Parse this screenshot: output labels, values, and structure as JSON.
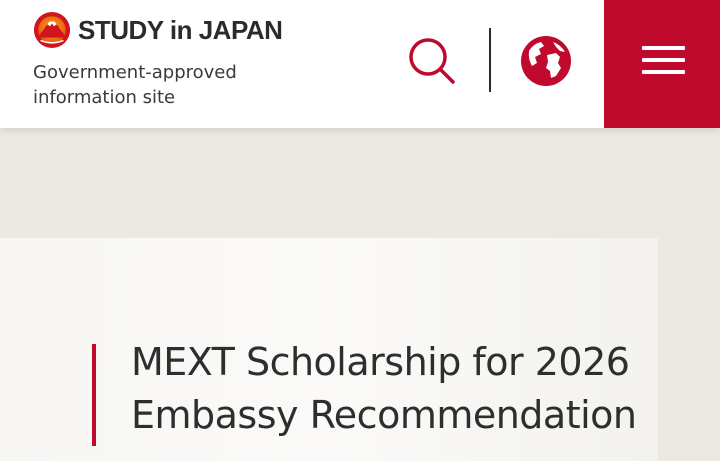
{
  "header": {
    "logo_text": "STUDY in JAPAN",
    "tagline_line1": "Government-approved",
    "tagline_line2": "information site",
    "search_icon": "search-icon",
    "language_icon": "globe-icon",
    "menu_icon": "hamburger-menu-icon"
  },
  "hero": {
    "title_line1": "MEXT Scholarship for 2026",
    "title_line2": "Embassy Recommendation"
  },
  "colors": {
    "brand_red": "#bf0a2e",
    "page_background": "#ece9e3",
    "text": "#2e2e2e"
  }
}
